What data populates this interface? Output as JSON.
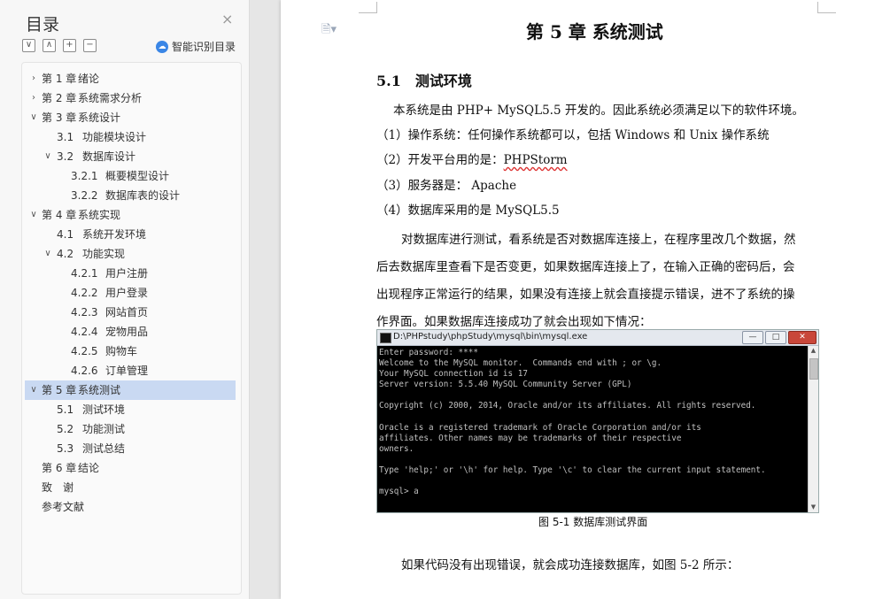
{
  "sidebar": {
    "title": "目录",
    "close_label": "×",
    "smart_label": "智能识别目录",
    "tools": [
      "∨",
      "∧",
      "+",
      "−"
    ],
    "items": [
      {
        "arrow": "›",
        "num": "第 1 章",
        "text": "绪论"
      },
      {
        "arrow": "›",
        "num": "第 2 章",
        "text": "系统需求分析"
      },
      {
        "arrow": "∨",
        "num": "第 3 章",
        "text": "系统设计"
      },
      {
        "arrow": "",
        "num": "3.1",
        "text": "功能模块设计"
      },
      {
        "arrow": "∨",
        "num": "3.2",
        "text": "数据库设计"
      },
      {
        "arrow": "",
        "num": "3.2.1",
        "text": "概要模型设计"
      },
      {
        "arrow": "",
        "num": "3.2.2",
        "text": "数据库表的设计"
      },
      {
        "arrow": "∨",
        "num": "第 4 章",
        "text": "系统实现"
      },
      {
        "arrow": "",
        "num": "4.1",
        "text": "系统开发环境"
      },
      {
        "arrow": "∨",
        "num": "4.2",
        "text": "功能实现"
      },
      {
        "arrow": "",
        "num": "4.2.1",
        "text": "用户注册"
      },
      {
        "arrow": "",
        "num": "4.2.2",
        "text": "用户登录"
      },
      {
        "arrow": "",
        "num": "4.2.3",
        "text": "网站首页"
      },
      {
        "arrow": "",
        "num": "4.2.4",
        "text": "宠物用品"
      },
      {
        "arrow": "",
        "num": "4.2.5",
        "text": "购物车"
      },
      {
        "arrow": "",
        "num": "4.2.6",
        "text": "订单管理"
      },
      {
        "arrow": "∨",
        "num": "第 5 章",
        "text": "系统测试"
      },
      {
        "arrow": "",
        "num": "5.1",
        "text": "测试环境"
      },
      {
        "arrow": "",
        "num": "5.2",
        "text": "功能测试"
      },
      {
        "arrow": "",
        "num": "5.3",
        "text": "测试总结"
      },
      {
        "arrow": "",
        "num": "第 6 章",
        "text": "结论"
      },
      {
        "arrow": "",
        "num": "致　谢",
        "text": ""
      },
      {
        "arrow": "",
        "num": "参考文献",
        "text": ""
      }
    ]
  },
  "document": {
    "chapter_title": "第 5 章  系统测试",
    "section_title": "5.1　测试环境",
    "intro": "本系统是由 PHP+ MySQL5.5 开发的。因此系统必须满足以下的软件环境。",
    "req1": "（1）操作系统：任何操作系统都可以，包括 Windows 和 Unix 操作系统",
    "req2_prefix": "（2）开发平台用的是：",
    "req2_value": "PHPStorm",
    "req3": "（3）服务器是：  Apache",
    "req4": "（4）数据库采用的是  MySQL5.5",
    "para_lines": [
      "对数据库进行测试，看系统是否对数据库连接上，在程序里改几个数据，然",
      "后去数据库里查看下是否变更，如果数据库连接上了，在输入正确的密码后，会",
      "出现程序正常运行的结果，如果没有连接上就会直接提示错误，进不了系统的操",
      "作界面。如果数据库连接成功了就会出现如下情况："
    ],
    "console": {
      "title": "D:\\PHPstudy\\phpStudy\\mysql\\bin\\mysql.exe",
      "min": "—",
      "max": "□",
      "close": "✕",
      "lines": [
        "Enter password: ****",
        "Welcome to the MySQL monitor.  Commands end with ; or \\g.",
        "Your MySQL connection id is 17",
        "Server version: 5.5.40 MySQL Community Server (GPL)",
        "",
        "Copyright (c) 2000, 2014, Oracle and/or its affiliates. All rights reserved.",
        "",
        "Oracle is a registered trademark of Oracle Corporation and/or its",
        "affiliates. Other names may be trademarks of their respective",
        "owners.",
        "",
        "Type 'help;' or '\\h' for help. Type '\\c' to clear the current input statement.",
        "",
        "mysql> a"
      ]
    },
    "caption": "图 5-1   数据库测试界面",
    "last_line": "如果代码没有出现错误，就会成功连接数据库，如图 5-2 所示："
  }
}
